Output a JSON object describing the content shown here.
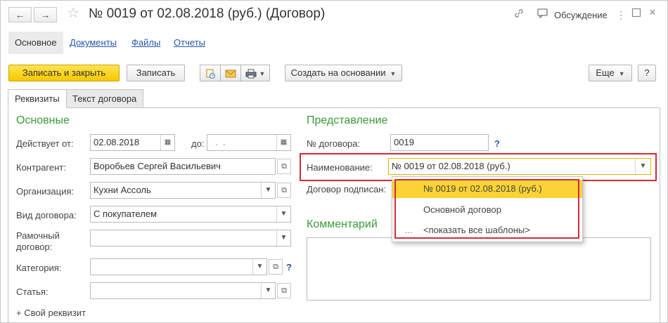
{
  "window": {
    "title": "№ 0019 от 02.08.2018 (руб.) (Договор)",
    "discussion_label": "Обсуждение",
    "back_glyph": "←",
    "forward_glyph": "→"
  },
  "nav": {
    "tabs": [
      {
        "label": "Основное",
        "active": true
      },
      {
        "label": "Документы",
        "active": false
      },
      {
        "label": "Файлы",
        "active": false
      },
      {
        "label": "Отчеты",
        "active": false
      }
    ]
  },
  "toolbar": {
    "save_close_label": "Записать и закрыть",
    "save_label": "Записать",
    "create_based_label": "Создать на основании",
    "more_label": "Еще",
    "help_label": "?"
  },
  "tabs": [
    {
      "label": "Реквизиты",
      "active": true
    },
    {
      "label": "Текст договора",
      "active": false
    }
  ],
  "left": {
    "section_title": "Основные",
    "valid_from_label": "Действует от:",
    "valid_from_value": "02.08.2018",
    "valid_to_label": "до:",
    "valid_to_value": "  .  .",
    "counterparty_label": "Контрагент:",
    "counterparty_value": "Воробьев Сергей Васильевич",
    "organization_label": "Организация:",
    "organization_value": "Кухни Ассоль",
    "contract_type_label": "Вид договора:",
    "contract_type_value": "С покупателем",
    "frame_contract_label_1": "Рамочный",
    "frame_contract_label_2": "договор:",
    "frame_contract_value": "",
    "category_label": "Категория:",
    "category_value": "",
    "article_label": "Статья:",
    "article_value": "",
    "add_property_label": "+ Свой реквизит",
    "help_q": "?"
  },
  "right": {
    "section_title": "Представление",
    "contract_no_label": "№ договора:",
    "contract_no_value": "0019",
    "name_label": "Наименование:",
    "name_value": "№ 0019 от 02.08.2018 (руб.)",
    "signed_label": "Договор подписан:",
    "comment_title": "Комментарий",
    "comment_value": "",
    "help_q": "?"
  },
  "dropdown": {
    "items": [
      {
        "label": "№ 0019 от 02.08.2018 (руб.)",
        "selected": true
      },
      {
        "label": "Основной договор",
        "selected": false
      },
      {
        "label": "<показать все шаблоны>",
        "selected": false,
        "prefix": "..."
      }
    ]
  },
  "colors": {
    "primary_button": "#f5c800",
    "section_green": "#3a9a3a",
    "link_blue": "#2358a6",
    "highlight_red": "#d42a3a",
    "selected_yellow": "#fbd335"
  }
}
